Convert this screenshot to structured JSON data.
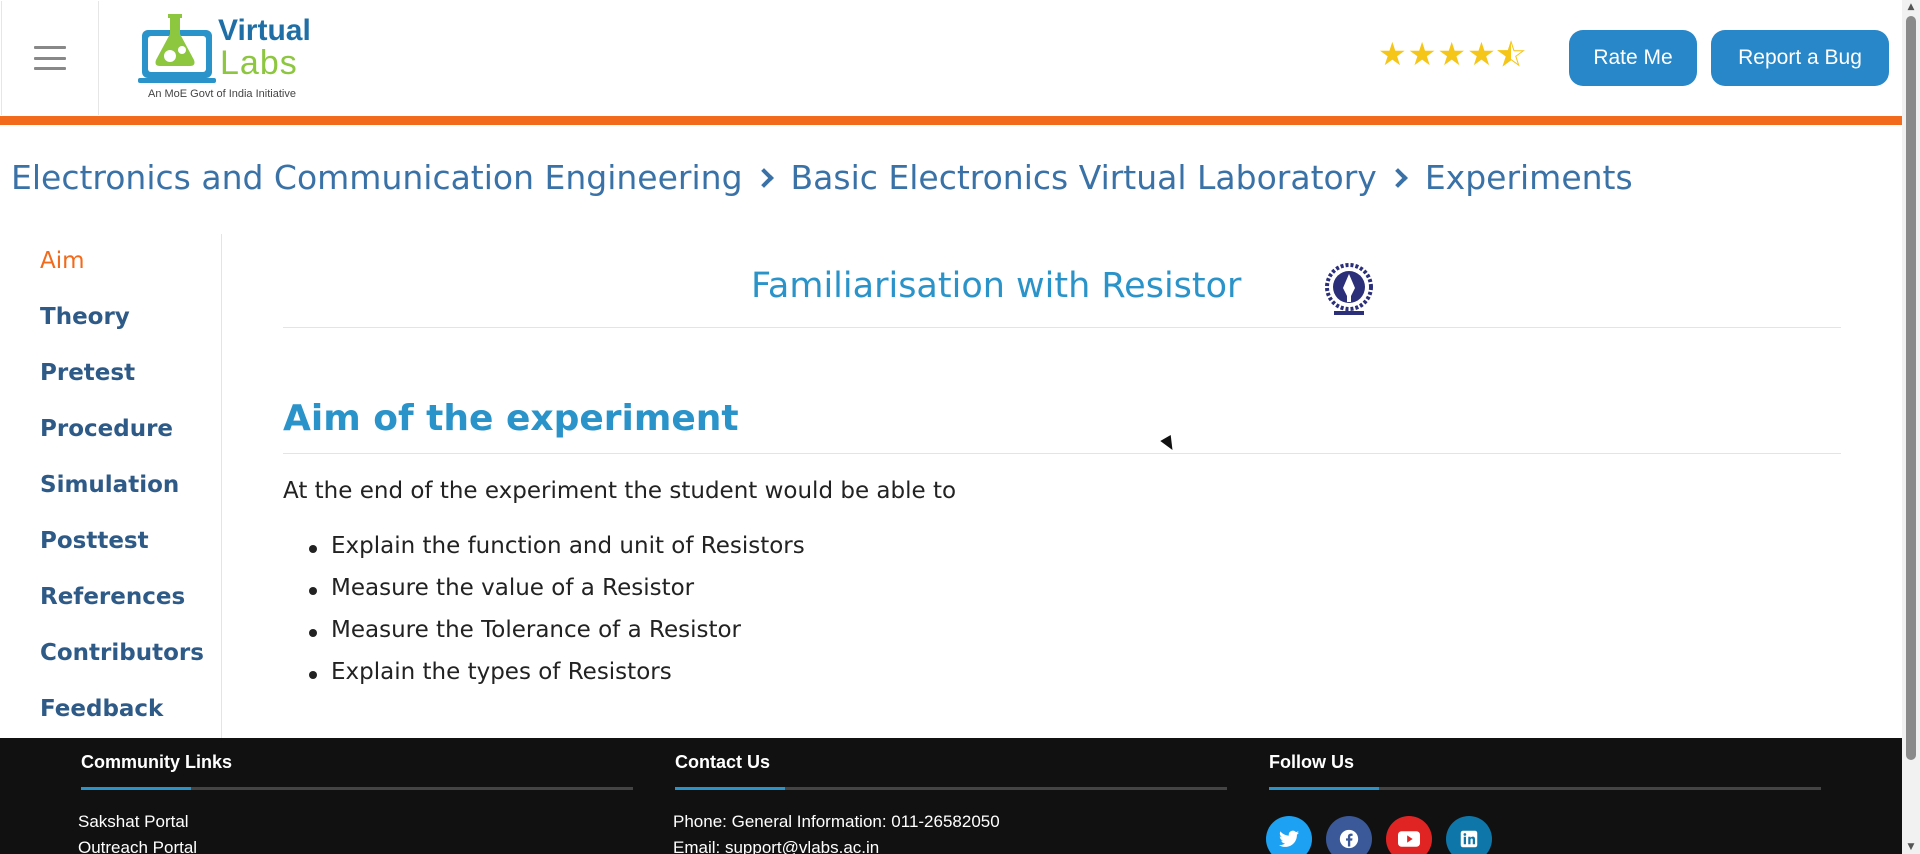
{
  "header": {
    "logo_title": "Virtual",
    "logo_subtitle": "Labs",
    "logo_tagline": "An MoE Govt of India Initiative",
    "rating": 4.5,
    "rate_button": "Rate Me",
    "bug_button": "Report a Bug"
  },
  "breadcrumb": {
    "items": [
      "Electronics and Communication Engineering",
      "Basic Electronics Virtual Laboratory",
      "Experiments"
    ]
  },
  "sidebar": {
    "items": [
      {
        "label": "Aim",
        "active": true
      },
      {
        "label": "Theory"
      },
      {
        "label": "Pretest"
      },
      {
        "label": "Procedure"
      },
      {
        "label": "Simulation"
      },
      {
        "label": "Posttest"
      },
      {
        "label": "References"
      },
      {
        "label": "Contributors"
      },
      {
        "label": "Feedback"
      }
    ]
  },
  "main": {
    "experiment_title": "Familiarisation with Resistor",
    "section_heading": "Aim of the experiment",
    "intro": "At the end of the experiment the student would be able to",
    "aims": [
      "Explain the function and unit of Resistors",
      "Measure the value of a Resistor",
      "Measure the Tolerance of a Resistor",
      "Explain the types of Resistors"
    ]
  },
  "footer": {
    "community": {
      "heading": "Community Links",
      "links": [
        "Sakshat Portal",
        "Outreach Portal"
      ]
    },
    "contact": {
      "heading": "Contact Us",
      "phone": "Phone: General Information: 011-26582050",
      "email": "Email: support@vlabs.ac.in"
    },
    "follow": {
      "heading": "Follow Us",
      "networks": [
        "twitter",
        "facebook",
        "youtube",
        "linkedin"
      ]
    }
  },
  "colors": {
    "accent_orange": "#f26b1d",
    "link_blue": "#2a93c9",
    "button_blue": "#2887c8",
    "footer_bg": "#111111"
  }
}
